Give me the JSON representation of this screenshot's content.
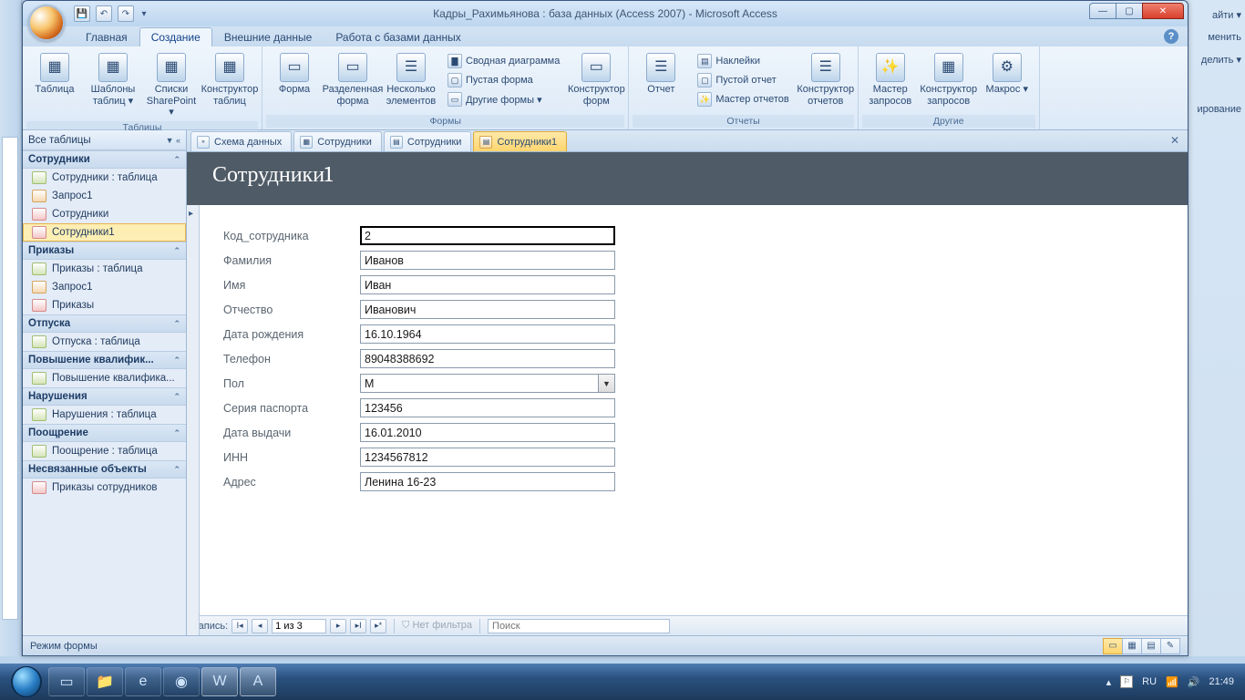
{
  "titlebar": {
    "title": "Кадры_Рахимьянова : база данных (Access 2007) - Microsoft Access"
  },
  "ribbon": {
    "tabs": [
      "Главная",
      "Создание",
      "Внешние данные",
      "Работа с базами данных"
    ],
    "active_tab": "Создание",
    "groups": {
      "tables": {
        "label": "Таблицы",
        "btn_table": "Таблица",
        "btn_templates": "Шаблоны таблиц ▾",
        "btn_sharepoint": "Списки SharePoint ▾",
        "btn_designer": "Конструктор таблиц"
      },
      "forms": {
        "label": "Формы",
        "btn_form": "Форма",
        "btn_split": "Разделенная форма",
        "btn_multi": "Несколько элементов",
        "btn_pivot": "Сводная диаграмма",
        "btn_blank": "Пустая форма",
        "btn_other": "Другие формы ▾",
        "btn_designer": "Конструктор форм"
      },
      "reports": {
        "label": "Отчеты",
        "btn_report": "Отчет",
        "btn_labels": "Наклейки",
        "btn_blank": "Пустой отчет",
        "btn_wizard": "Мастер отчетов",
        "btn_designer": "Конструктор отчетов"
      },
      "other": {
        "label": "Другие",
        "btn_qwizard": "Мастер запросов",
        "btn_qdesigner": "Конструктор запросов",
        "btn_macro": "Макрос ▾"
      }
    }
  },
  "nav": {
    "header": "Все таблицы",
    "groups": [
      {
        "name": "Сотрудники",
        "items": [
          {
            "label": "Сотрудники : таблица",
            "type": "tbl"
          },
          {
            "label": "Запрос1",
            "type": "qry"
          },
          {
            "label": "Сотрудники",
            "type": "frm"
          },
          {
            "label": "Сотрудники1",
            "type": "frm",
            "sel": true
          }
        ]
      },
      {
        "name": "Приказы",
        "items": [
          {
            "label": "Приказы : таблица",
            "type": "tbl"
          },
          {
            "label": "Запрос1",
            "type": "qry"
          },
          {
            "label": "Приказы",
            "type": "frm"
          }
        ]
      },
      {
        "name": "Отпуска",
        "items": [
          {
            "label": "Отпуска : таблица",
            "type": "tbl"
          }
        ]
      },
      {
        "name": "Повышение квалифик...",
        "items": [
          {
            "label": "Повышение квалифика...",
            "type": "tbl"
          }
        ]
      },
      {
        "name": "Нарушения",
        "items": [
          {
            "label": "Нарушения : таблица",
            "type": "tbl"
          }
        ]
      },
      {
        "name": "Поощрение",
        "items": [
          {
            "label": "Поощрение : таблица",
            "type": "tbl"
          }
        ]
      },
      {
        "name": "Несвязанные объекты",
        "items": [
          {
            "label": "Приказы сотрудников",
            "type": "frm"
          }
        ]
      }
    ]
  },
  "doc_tabs": [
    {
      "label": "Схема данных",
      "icon": "⚬"
    },
    {
      "label": "Сотрудники",
      "icon": "▦"
    },
    {
      "label": "Сотрудники",
      "icon": "▤"
    },
    {
      "label": "Сотрудники1",
      "icon": "▤",
      "active": true
    }
  ],
  "form": {
    "title": "Сотрудники1",
    "fields": [
      {
        "label": "Код_сотрудника",
        "value": "2",
        "focused": true
      },
      {
        "label": "Фамилия",
        "value": "Иванов"
      },
      {
        "label": "Имя",
        "value": "Иван"
      },
      {
        "label": "Отчество",
        "value": "Иванович"
      },
      {
        "label": "Дата рождения",
        "value": "16.10.1964"
      },
      {
        "label": "Телефон",
        "value": "89048388692"
      },
      {
        "label": "Пол",
        "value": "М",
        "select": true
      },
      {
        "label": "Серия паспорта",
        "value": "123456"
      },
      {
        "label": "Дата выдачи",
        "value": "16.01.2010"
      },
      {
        "label": "ИНН",
        "value": "1234567812"
      },
      {
        "label": "Адрес",
        "value": "Ленина 16-23"
      }
    ]
  },
  "recnav": {
    "label": "Запись:",
    "pos": "1 из 3",
    "filter": "Нет фильтра",
    "search": "Поиск"
  },
  "statusbar": {
    "mode": "Режим формы"
  },
  "bg_menu": [
    "айти ▾",
    "менить",
    "делить ▾",
    "ирование"
  ],
  "taskbar": {
    "lang": "RU",
    "time": "21:49"
  }
}
